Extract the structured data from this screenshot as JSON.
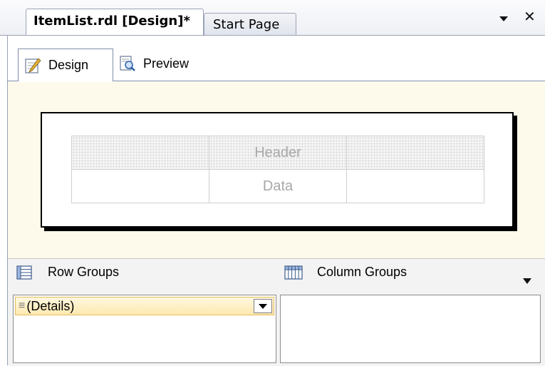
{
  "document_tabs": [
    {
      "label": "ItemList.rdl [Design]*",
      "active": true
    },
    {
      "label": "Start Page",
      "active": false
    }
  ],
  "window_controls": {
    "dropdown_icon": "chevron-down-icon",
    "close_label": "✕"
  },
  "view_tabs": [
    {
      "label": "Design",
      "icon": "design-icon",
      "active": true
    },
    {
      "label": "Preview",
      "icon": "preview-icon",
      "active": false
    }
  ],
  "report": {
    "tablix": {
      "header_row": [
        "",
        "Header",
        ""
      ],
      "data_row": [
        "",
        "Data",
        ""
      ]
    }
  },
  "grouping": {
    "row_groups": {
      "label": "Row Groups",
      "icon": "row-groups-icon",
      "items": [
        {
          "label": "(Details)",
          "icon": "details-group-icon"
        }
      ]
    },
    "column_groups": {
      "label": "Column Groups",
      "icon": "column-groups-icon",
      "items": []
    }
  },
  "colors": {
    "surface": "#fdfaeb",
    "selection": "#fde9b0",
    "border": "#9aa3b5"
  }
}
